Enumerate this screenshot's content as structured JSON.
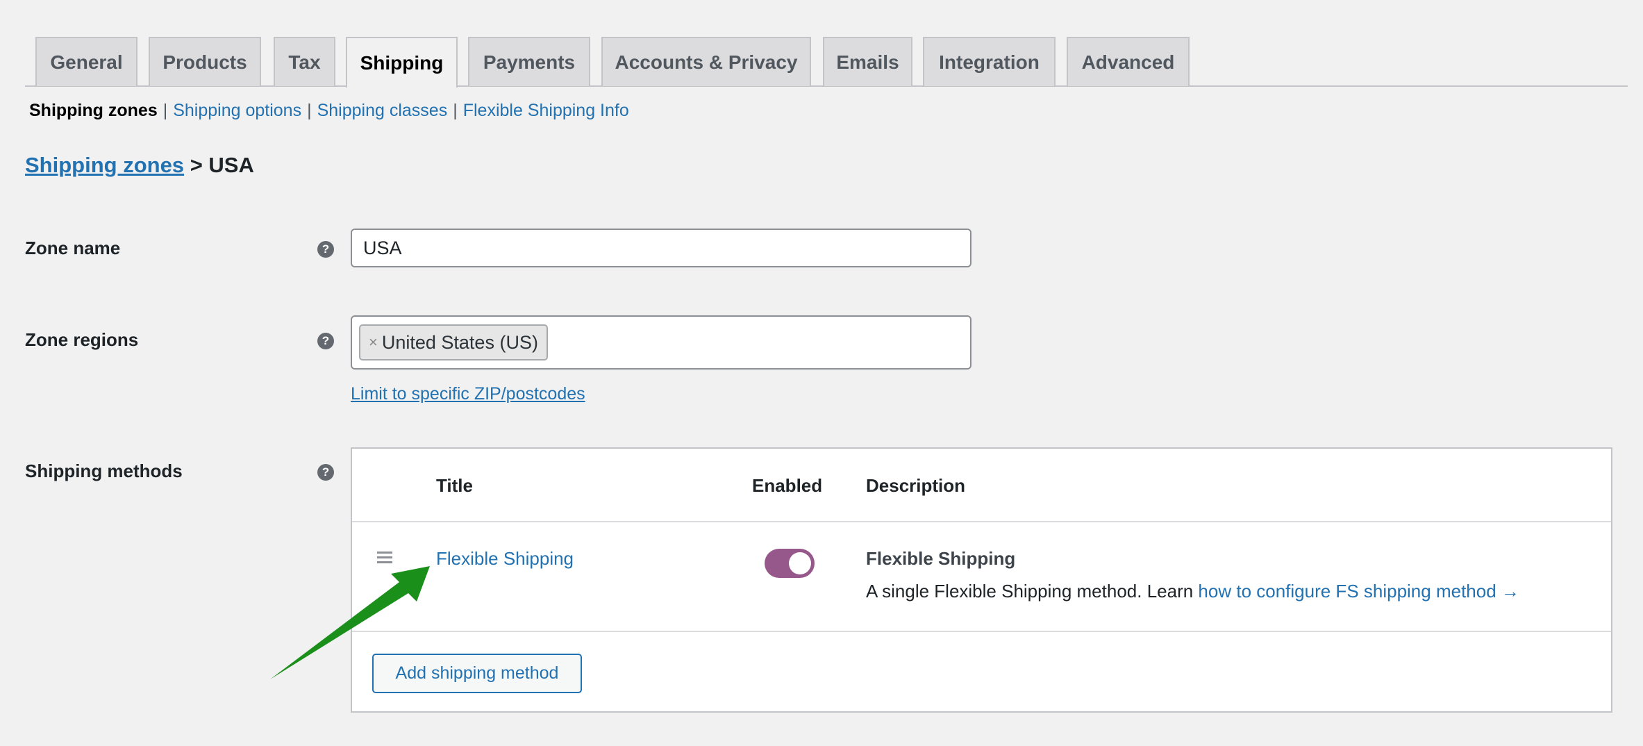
{
  "tabs": [
    {
      "label": "General"
    },
    {
      "label": "Products"
    },
    {
      "label": "Tax"
    },
    {
      "label": "Shipping",
      "active": true
    },
    {
      "label": "Payments"
    },
    {
      "label": "Accounts & Privacy"
    },
    {
      "label": "Emails"
    },
    {
      "label": "Integration"
    },
    {
      "label": "Advanced"
    }
  ],
  "subnav": {
    "current": "Shipping zones",
    "links": [
      "Shipping options",
      "Shipping classes",
      "Flexible Shipping Info"
    ]
  },
  "breadcrumb": {
    "link": "Shipping zones",
    "separator": ">",
    "current": "USA"
  },
  "zone_name": {
    "label": "Zone name",
    "value": "USA"
  },
  "zone_regions": {
    "label": "Zone regions",
    "chips": [
      "United States (US)"
    ],
    "limit_link": "Limit to specific ZIP/postcodes"
  },
  "shipping_methods": {
    "label": "Shipping methods",
    "columns": [
      "Title",
      "Enabled",
      "Description"
    ],
    "rows": [
      {
        "title": "Flexible Shipping",
        "enabled": true,
        "desc_title": "Flexible Shipping",
        "desc_text": "A single Flexible Shipping method. Learn",
        "desc_link": "how to configure FS shipping method →"
      }
    ],
    "add_button": "Add shipping method"
  },
  "colors": {
    "link": "#2271b1",
    "toggle_on": "#96588a",
    "annotation_arrow": "#1a8f1a"
  },
  "icons": {
    "help": "question-circle-icon",
    "drag": "drag-handle-icon",
    "remove": "close-icon"
  }
}
